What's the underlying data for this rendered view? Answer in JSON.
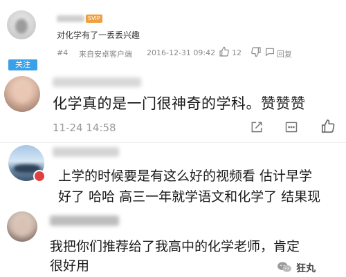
{
  "comment_1": {
    "badge": "SVIP",
    "text": "对化学有了一丢丢兴趣",
    "floor": "#4",
    "source": "来自安卓客户端",
    "time": "2016-12-31 09:42",
    "like_count": "12",
    "reply_label": "回复",
    "follow_label": "关注"
  },
  "comment_2": {
    "text": "化学真的是一门很神奇的学科。赞赞赞",
    "time": "11-24 14:58"
  },
  "comment_3": {
    "line1": "上学的时候要是有这么好的视频看 估计早学",
    "line2": "好了 哈哈 高三一年就学语文和化学了 结果现"
  },
  "comment_4": {
    "line1": "我把你们推荐给了我高中的化学老师，肯定",
    "line2": "很好用"
  },
  "watermark": {
    "text": "狂丸",
    "icon": "wechat-icon"
  },
  "colors": {
    "follow_button": "#3aa0e8",
    "badge": "#f0a040",
    "meta_text": "#888888",
    "body_text": "#1a1a1a"
  }
}
